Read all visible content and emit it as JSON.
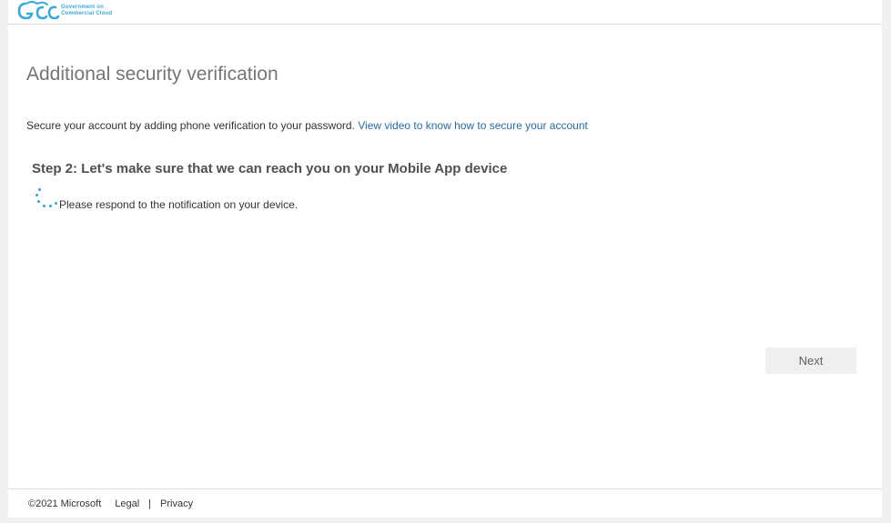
{
  "header": {
    "logo_text_line1": "Government on",
    "logo_text_line2": "Commercial Cloud",
    "logo_mark": "GCC",
    "brand_color": "#3aa9d6"
  },
  "main": {
    "title": "Additional security verification",
    "intro_text": "Secure your account by adding phone verification to your password.",
    "intro_link": "View video to know how to secure your account",
    "step_heading": "Step 2: Let's make sure that we can reach you on your Mobile App device",
    "status_text": "Please respond to the notification on your device.",
    "spinner_icon": "loading-spinner-icon",
    "link_color": "#2a6aa0"
  },
  "actions": {
    "next_label": "Next"
  },
  "footer": {
    "copyright": "©2021 Microsoft",
    "legal_label": "Legal",
    "separator": "|",
    "privacy_label": "Privacy"
  }
}
